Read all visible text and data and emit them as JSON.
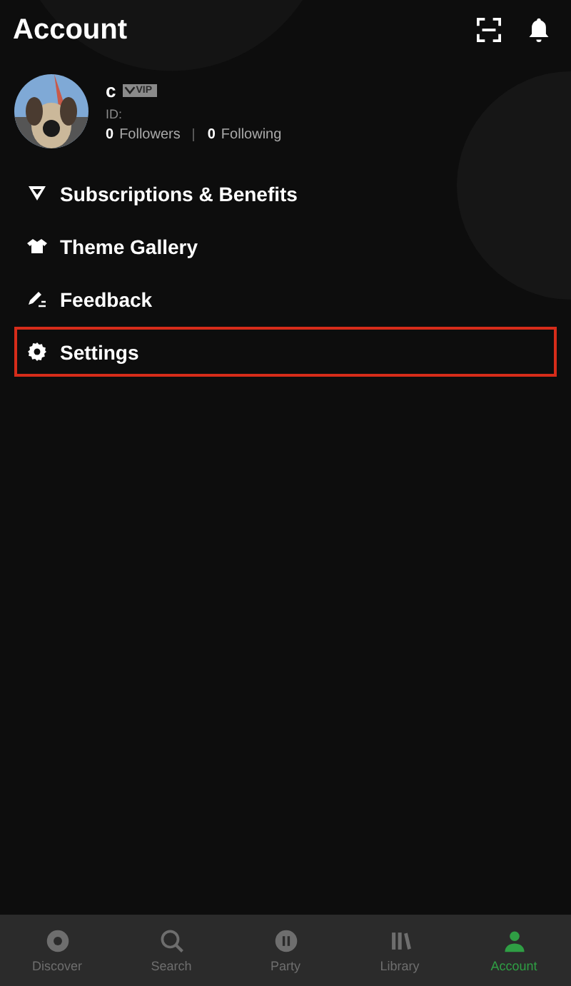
{
  "header": {
    "title": "Account"
  },
  "profile": {
    "name": "c",
    "badge": "VIP",
    "id_label": "ID:",
    "followers_count": "0",
    "followers_label": "Followers",
    "following_count": "0",
    "following_label": "Following"
  },
  "menu": [
    {
      "kind": "diamond",
      "label": "Subscriptions & Benefits",
      "highlighted": false
    },
    {
      "kind": "shirt",
      "label": "Theme Gallery",
      "highlighted": false
    },
    {
      "kind": "pen",
      "label": "Feedback",
      "highlighted": false
    },
    {
      "kind": "gear",
      "label": "Settings",
      "highlighted": true
    }
  ],
  "tabs": [
    {
      "kind": "discover",
      "label": "Discover",
      "selected": false
    },
    {
      "kind": "search",
      "label": "Search",
      "selected": false
    },
    {
      "kind": "party",
      "label": "Party",
      "selected": false
    },
    {
      "kind": "library",
      "label": "Library",
      "selected": false
    },
    {
      "kind": "account",
      "label": "Account",
      "selected": true
    }
  ]
}
